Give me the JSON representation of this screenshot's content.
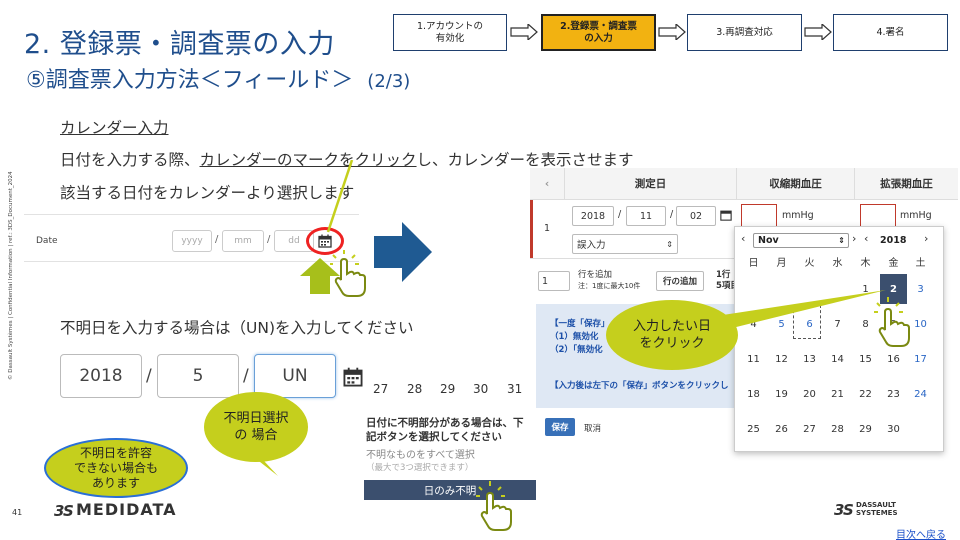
{
  "header": {
    "title": "2. 登録票・調査票の入力",
    "subtitle": "⑤調査票入力方法＜フィールド＞",
    "page_indicator": "(2/3)"
  },
  "steps": [
    {
      "line1": "1.アカウントの",
      "line2": "有効化",
      "active": false
    },
    {
      "line1": "2.登録票・調査票",
      "line2": "の入力",
      "active": true
    },
    {
      "line1": "3.再調査対応",
      "line2": "",
      "active": false
    },
    {
      "line1": "4.署名",
      "line2": "",
      "active": false
    }
  ],
  "side_note": "© Dassault Systèmes | Confidential Information | ref.: 3DS_Document_2024",
  "instructions": {
    "heading": "カレンダー入力",
    "line1_prefix": "日付を入力する際、",
    "line1_link": "カレンダーのマークをクリック",
    "line1_suffix": "し、カレンダーを表示させます",
    "line2": "該当する日付をカレンダーより選択します",
    "unknown_note": "不明日を入力する場合は（UN)を入力してください"
  },
  "date_form": {
    "label": "Date",
    "year_placeholder": "yyyy",
    "month_placeholder": "mm",
    "day_placeholder": "dd",
    "separator": "/"
  },
  "unknown_fields": {
    "year": "2018",
    "month": "5",
    "day": "UN",
    "separator": "/",
    "calendar_tail": [
      "27",
      "28",
      "29",
      "30",
      "31"
    ]
  },
  "unknown_popup": {
    "line1": "日付に不明部分がある場合は、下",
    "line2": "記ボタンを選択してください",
    "line3": "不明なものをすべて選択",
    "line4": "（最大で3つ選択できます）",
    "button": "日のみ不明"
  },
  "callouts": {
    "unknown_select": [
      "不明日選択",
      "の 場合"
    ],
    "not_allowed": [
      "不明日を許容",
      "できない場合も",
      "あります"
    ],
    "click_date": [
      "入力したい日",
      "をクリック"
    ]
  },
  "grid": {
    "headers": [
      "測定日",
      "収縮期血圧",
      "拡張期血圧"
    ],
    "row_number": "1",
    "year": "2018",
    "month": "11",
    "day": "02",
    "unit": "mmHg",
    "status_select": "誤入力",
    "add_count": "1",
    "add_label": "行を追加",
    "add_note": "注：1度に最大10件",
    "add_button": "行の追加",
    "row_count_1": "1行",
    "row_count_2": "5項目",
    "info_line1": "【一度「保存」",
    "info_line2": "（1）無効化",
    "info_line3": "（2）「無効化",
    "info_bottom": "【入力後は左下の「保存」ボタンをクリックし",
    "save": "保存",
    "cancel": "取消"
  },
  "calendar": {
    "month": "Nov",
    "year": "2018",
    "weekdays": [
      "日",
      "月",
      "火",
      "水",
      "木",
      "金",
      "土"
    ],
    "weeks": [
      [
        "",
        "",
        "",
        "",
        "1",
        "2",
        "3"
      ],
      [
        "4",
        "5",
        "6",
        "7",
        "8",
        "9",
        "10"
      ],
      [
        "11",
        "12",
        "13",
        "14",
        "15",
        "16",
        "17"
      ],
      [
        "18",
        "19",
        "20",
        "21",
        "22",
        "23",
        "24"
      ],
      [
        "25",
        "26",
        "27",
        "28",
        "29",
        "30",
        ""
      ]
    ],
    "selected_day": "2"
  },
  "footer": {
    "page_number": "41",
    "logo_left": "MEDIDATA",
    "logo_right_1": "DASSAULT",
    "logo_right_2": "SYSTEMES",
    "toc_link": "目次へ戻る"
  }
}
